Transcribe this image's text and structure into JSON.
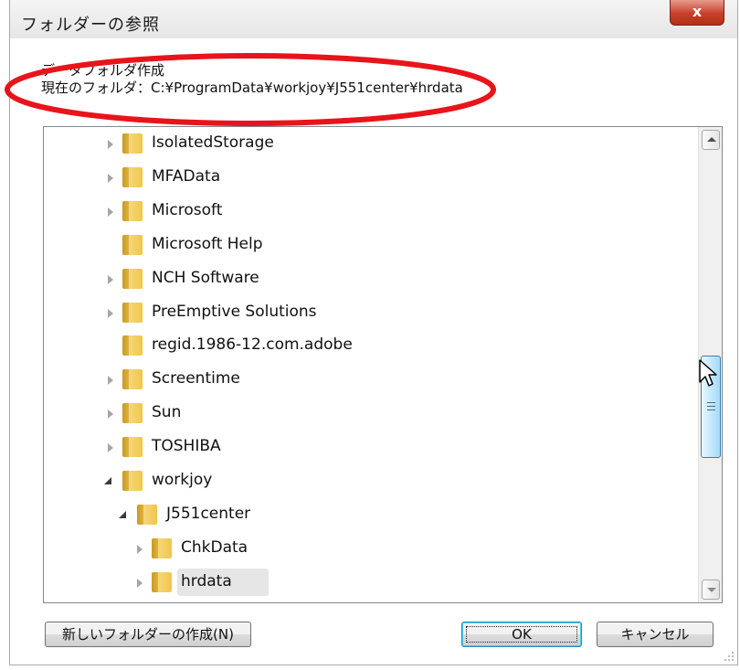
{
  "window": {
    "title": "フォルダーの参照",
    "close_label": "x"
  },
  "description": {
    "line1": "データフォルダ作成",
    "line2": "現在のフォルダ：C:¥ProgramData¥workjoy¥J551center¥hrdata"
  },
  "tree": {
    "items": [
      {
        "label": "IsolatedStorage",
        "level": 0,
        "expander": "collapsed"
      },
      {
        "label": "MFAData",
        "level": 0,
        "expander": "collapsed"
      },
      {
        "label": "Microsoft",
        "level": 0,
        "expander": "collapsed"
      },
      {
        "label": "Microsoft Help",
        "level": 0,
        "expander": "none"
      },
      {
        "label": "NCH Software",
        "level": 0,
        "expander": "collapsed"
      },
      {
        "label": "PreEmptive Solutions",
        "level": 0,
        "expander": "collapsed"
      },
      {
        "label": "regid.1986-12.com.adobe",
        "level": 0,
        "expander": "none"
      },
      {
        "label": "Screentime",
        "level": 0,
        "expander": "collapsed"
      },
      {
        "label": "Sun",
        "level": 0,
        "expander": "collapsed"
      },
      {
        "label": "TOSHIBA",
        "level": 0,
        "expander": "collapsed"
      },
      {
        "label": "workjoy",
        "level": 0,
        "expander": "expanded"
      },
      {
        "label": "J551center",
        "level": 1,
        "expander": "expanded"
      },
      {
        "label": "ChkData",
        "level": 2,
        "expander": "collapsed"
      },
      {
        "label": "hrdata",
        "level": 2,
        "expander": "collapsed",
        "selected": true
      }
    ]
  },
  "buttons": {
    "new_folder": "新しいフォルダーの作成(N)",
    "ok": "OK",
    "cancel": "キャンセル"
  },
  "colors": {
    "annotation_ellipse": "#e8141b",
    "close_button": "#c6402a",
    "scroll_thumb": "#bee6fd"
  },
  "icons": {
    "folder": "folder-icon",
    "close": "close-icon",
    "cursor": "mouse-pointer-icon"
  }
}
